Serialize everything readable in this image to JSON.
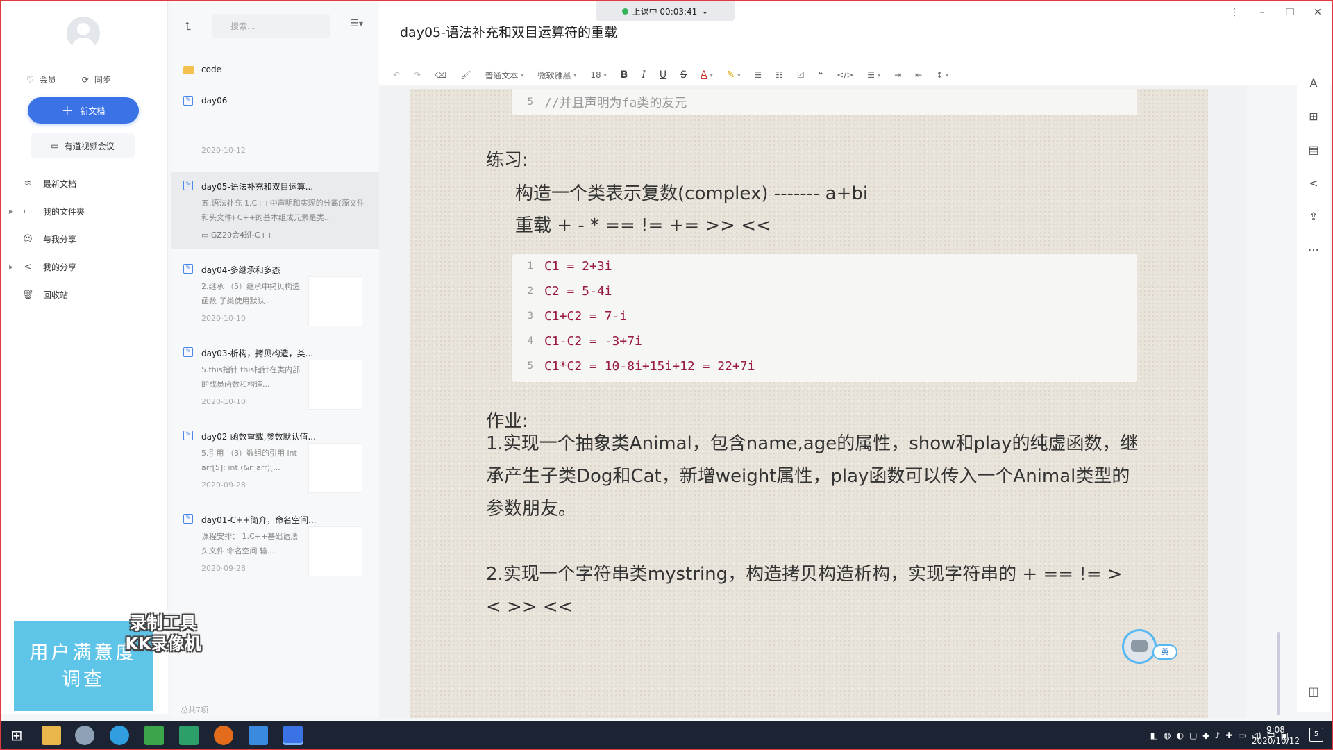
{
  "sidebar": {
    "vip_label": "会员",
    "sync_label": "同步",
    "new_doc_label": "新文档",
    "meeting_label": "有道视频会议",
    "nav": [
      {
        "label": "最新文档",
        "icon": "layers-icon"
      },
      {
        "label": "我的文件夹",
        "icon": "folder-icon"
      },
      {
        "label": "与我分享",
        "icon": "people-icon"
      },
      {
        "label": "我的分享",
        "icon": "share-icon"
      },
      {
        "label": "回收站",
        "icon": "trash-icon"
      }
    ],
    "survey_line1": "用户满意度",
    "survey_line2": "调查",
    "watermark_line1": "录制工具",
    "watermark_line2": "KK录像机"
  },
  "doclist": {
    "search_placeholder": "搜索...",
    "folder_name": "code",
    "docs": [
      {
        "name": "day06",
        "snippet": "",
        "date": "2020-10-12"
      },
      {
        "name": "day05-语法补充和双目运算...",
        "snippet": "五.语法补充 1.C++中声明和实现的分离(源文件和头文件) C++的基本组成元素是类...",
        "folder": "GZ20会4班-C++"
      },
      {
        "name": "day04-多继承和多态",
        "snippet": "2.继承 （5）继承中拷贝构造函数 子类使用默认...",
        "date": "2020-10-10"
      },
      {
        "name": "day03-析构，拷贝构造，类...",
        "snippet": "5.this指针 this指针在类内部的成员函数和构造...",
        "date": "2020-10-10"
      },
      {
        "name": "day02-函数重载,参数默认值...",
        "snippet": "5.引用 （3）数组的引用 int arr[5]; int (&r_arr)[...",
        "date": "2020-09-28"
      },
      {
        "name": "day01-C++简介，命名空间...",
        "snippet": "课程安排： 1.C++基础语法 头文件 命名空间 输...",
        "date": "2020-09-28"
      }
    ],
    "footer": "总共7项"
  },
  "header": {
    "title": "day05-语法补充和双目运算符的重载",
    "recording": "上课中 00:03:41"
  },
  "toolbar": {
    "style": "普通文本",
    "font": "微软雅黑",
    "size": "18"
  },
  "editor": {
    "top_code_line_no": "5",
    "top_code_line": "//并且声明为fa类的友元",
    "exercise_heading": "练习:",
    "exercise_line1": "构造一个类表示复数(complex) ------- a+bi",
    "exercise_line2": "重载 + - * == != += >> <<",
    "code_lines": [
      {
        "no": "1",
        "text": "C1 = 2+3i"
      },
      {
        "no": "2",
        "text": "C2 = 5-4i"
      },
      {
        "no": "3",
        "text": "C1+C2 = 7-i"
      },
      {
        "no": "4",
        "text": "C1-C2 = -3+7i"
      },
      {
        "no": "5",
        "text": "C1*C2 = 10-8i+15i+12 = 22+7i"
      }
    ],
    "homework_heading": "作业:",
    "homework_1": "1.实现一个抽象类Animal，包含name,age的属性，show和play的纯虚函数，继承产生子类Dog和Cat，新增weight属性，play函数可以传入一个Animal类型的参数朋友。",
    "homework_2": "2.实现一个字符串类mystring，构造拷贝构造析构，实现字符串的 + == != > < >> <<"
  },
  "assistant_lang": "英",
  "taskbar": {
    "time": "9:08",
    "date": "2020/10/12",
    "ime": "中",
    "notif_count": "5"
  }
}
